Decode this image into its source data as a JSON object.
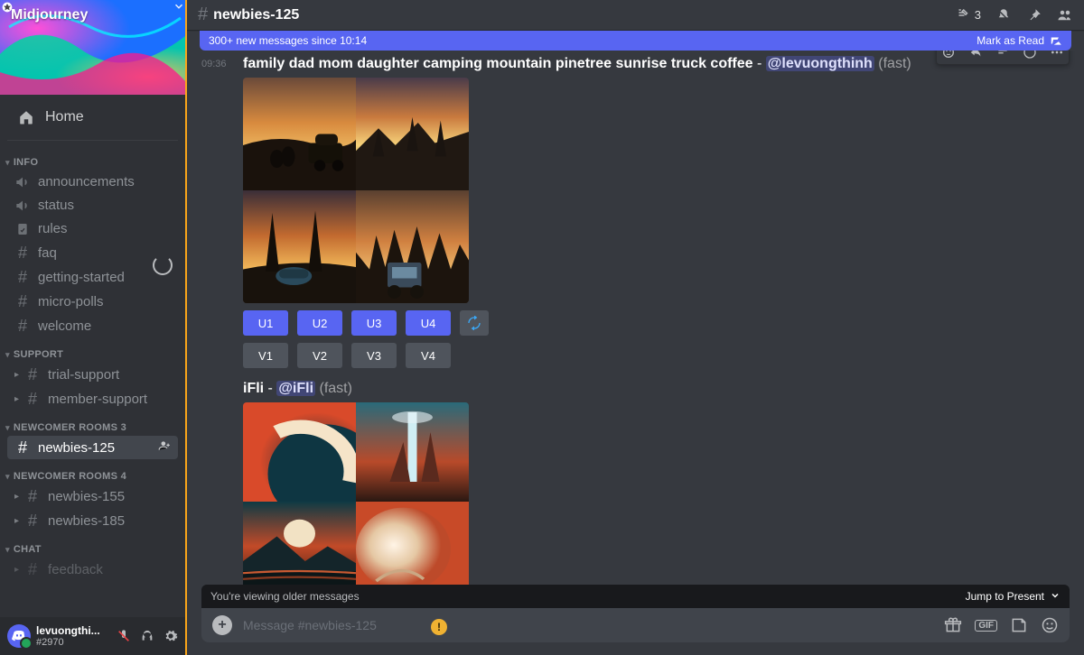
{
  "server": {
    "name": "Midjourney"
  },
  "nav": {
    "home": "Home",
    "categories": [
      {
        "name": "INFO",
        "channels": [
          {
            "icon": "mega",
            "label": "announcements"
          },
          {
            "icon": "mega",
            "label": "status"
          },
          {
            "icon": "rules",
            "label": "rules"
          },
          {
            "icon": "hash",
            "label": "faq"
          },
          {
            "icon": "hash",
            "label": "getting-started"
          },
          {
            "icon": "hash",
            "label": "micro-polls"
          },
          {
            "icon": "hash",
            "label": "welcome"
          }
        ]
      },
      {
        "name": "SUPPORT",
        "channels": [
          {
            "icon": "hash",
            "label": "trial-support",
            "thread": true
          },
          {
            "icon": "hash",
            "label": "member-support",
            "thread": true
          }
        ]
      },
      {
        "name": "NEWCOMER ROOMS 3",
        "channels": [
          {
            "icon": "hash",
            "label": "newbies-125",
            "selected": true,
            "adduser": true
          }
        ]
      },
      {
        "name": "NEWCOMER ROOMS 4",
        "channels": [
          {
            "icon": "hash",
            "label": "newbies-155",
            "thread": true
          },
          {
            "icon": "hash",
            "label": "newbies-185",
            "thread": true
          }
        ]
      },
      {
        "name": "CHAT",
        "channels": [
          {
            "icon": "hash",
            "label": "feedback",
            "thread": true,
            "cut": true
          }
        ]
      }
    ]
  },
  "user": {
    "name": "levuongthi...",
    "tag": "#2970"
  },
  "header": {
    "channel": "newbies-125",
    "threads_count": "3"
  },
  "new_messages": {
    "text": "300+ new messages since 10:14",
    "mark": "Mark as Read"
  },
  "messages": [
    {
      "timestamp": "09:36",
      "prompt_text": "family dad mom daughter camping mountain pinetree sunrise truck coffee",
      "mention": "@levuongthinh",
      "mode": "(fast)",
      "u_buttons": [
        "U1",
        "U2",
        "U3",
        "U4"
      ],
      "v_buttons": [
        "V1",
        "V2",
        "V3",
        "V4"
      ]
    },
    {
      "author": "iFli",
      "mention": "@iFli",
      "mode": "(fast)"
    }
  ],
  "older": {
    "text": "You're viewing older messages",
    "jump": "Jump to Present"
  },
  "input": {
    "placeholder": "Message #newbies-125"
  },
  "colors": {
    "blurple": "#5865f2",
    "grey": "#4f545c",
    "gold": "#f0b232"
  }
}
